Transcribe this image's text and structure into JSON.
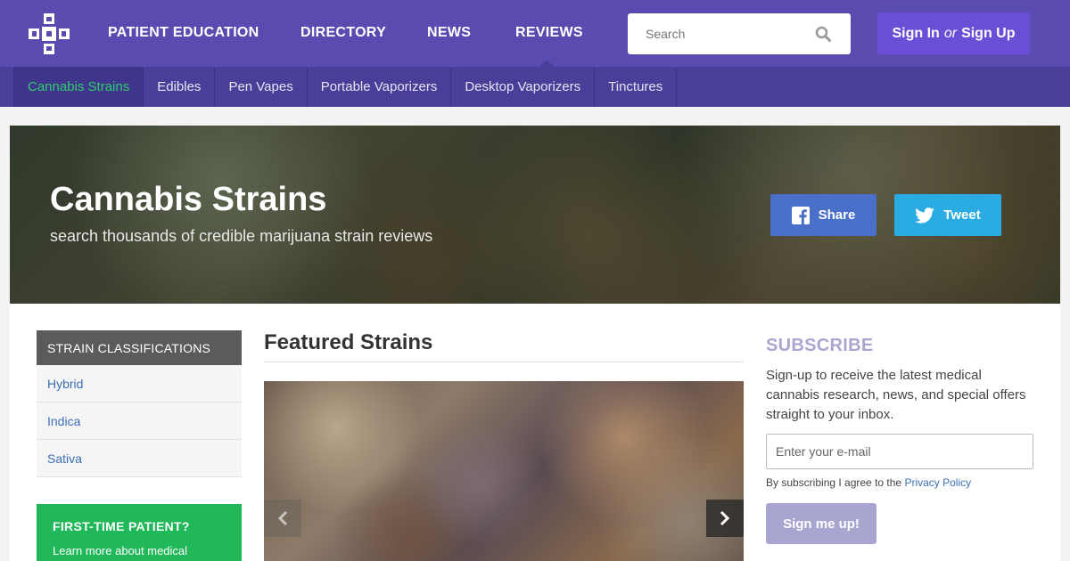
{
  "colors": {
    "brand_purple": "#5a4bb0",
    "subnav_purple": "#4a3f98",
    "active_green": "#2ecc71",
    "facebook_blue": "#4a6fc8",
    "twitter_blue": "#2aace2",
    "cta_green": "#21b85a",
    "link_blue": "#3b6fb5"
  },
  "header": {
    "logo_icon": "medical-cross-logo-icon",
    "nav": [
      {
        "label": "PATIENT EDUCATION"
      },
      {
        "label": "DIRECTORY"
      },
      {
        "label": "NEWS"
      },
      {
        "label": "REVIEWS"
      }
    ],
    "search": {
      "placeholder": "Search",
      "value": "",
      "icon": "search-icon"
    },
    "auth": {
      "sign_in": "Sign In",
      "or": "or",
      "sign_up": "Sign Up"
    }
  },
  "subnav": {
    "items": [
      {
        "label": "Cannabis Strains"
      },
      {
        "label": "Edibles"
      },
      {
        "label": "Pen Vapes"
      },
      {
        "label": "Portable Vaporizers"
      },
      {
        "label": "Desktop Vaporizers"
      },
      {
        "label": "Tinctures"
      }
    ],
    "active": "Cannabis Strains"
  },
  "hero": {
    "title": "Cannabis Strains",
    "subtitle": "search thousands of credible marijuana strain reviews",
    "share_label": "Share",
    "tweet_label": "Tweet"
  },
  "sidebar": {
    "heading": "STRAIN CLASSIFICATIONS",
    "items": [
      {
        "label": "Hybrid"
      },
      {
        "label": "Indica"
      },
      {
        "label": "Sativa"
      }
    ],
    "first_time": {
      "title": "FIRST-TIME PATIENT?",
      "text": "Learn more about medical"
    }
  },
  "featured": {
    "title": "Featured Strains"
  },
  "subscribe": {
    "title": "SUBSCRIBE",
    "text": "Sign-up to receive the latest medical cannabis research, news, and special offers straight to your inbox.",
    "email_placeholder": "Enter your e-mail",
    "legal_prefix": "By subscribing I agree to the",
    "legal_link": "Privacy Policy",
    "button_label": "Sign me up!"
  }
}
